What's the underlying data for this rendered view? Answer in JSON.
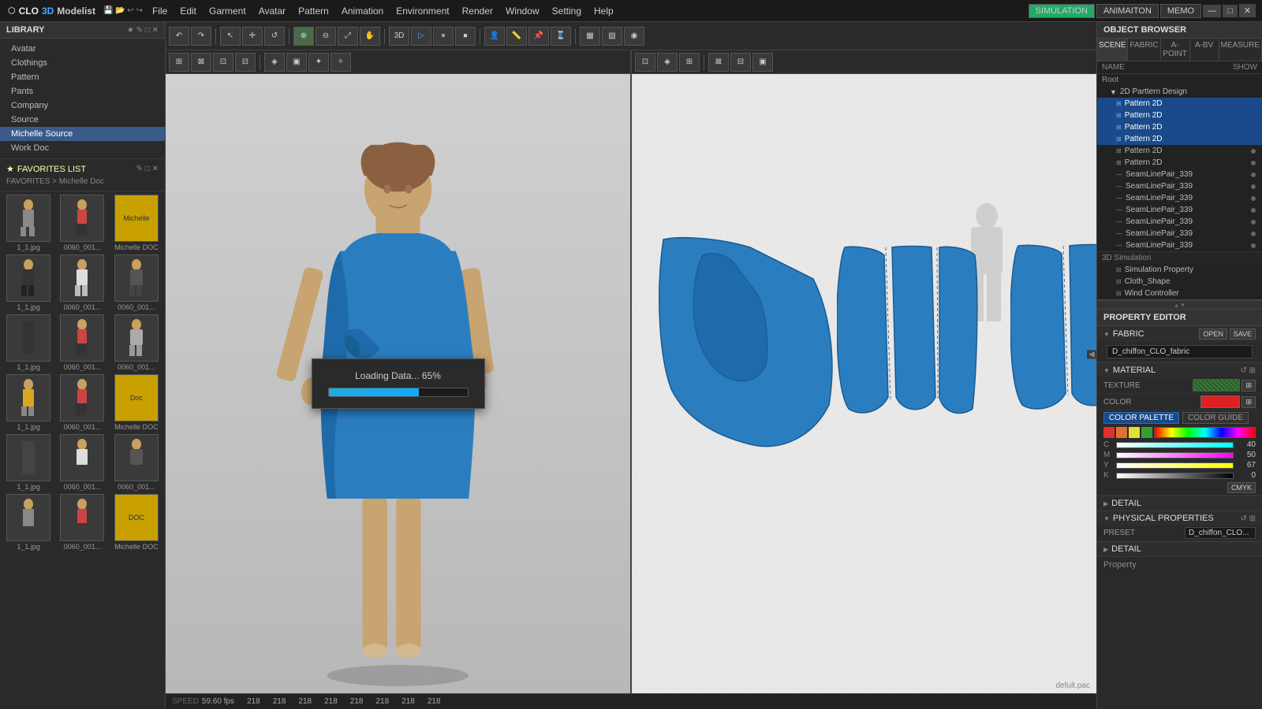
{
  "app": {
    "title": "CLO 3D Modelist",
    "logo_clo": "CLO",
    "logo_3d": "3D",
    "logo_modelist": "Modelist"
  },
  "topbar_buttons": {
    "simulation": "SIMULATION",
    "animation": "ANIMAITON",
    "memo": "MEMO",
    "minimize": "—",
    "maximize": "□",
    "close": "✕"
  },
  "menu": {
    "items": [
      "File",
      "Edit",
      "Garment",
      "Avatar",
      "Pattern",
      "Animation",
      "Environment",
      "Render",
      "Window",
      "Setting",
      "Help"
    ]
  },
  "sidebar": {
    "title": "LIBRARY",
    "nav_items": [
      "Avatar",
      "Clothings",
      "Pattern",
      "Pants",
      "Company",
      "Source",
      "Michelle Source",
      "Work Doc"
    ],
    "active_item": "Michelle Source",
    "favorites_label": "FAVORITES LIST",
    "favorites_path": "FAVORITES > Michelle Doc",
    "thumbnails": [
      {
        "label": "1_1.jpg",
        "type": "figure"
      },
      {
        "label": "0060_001...",
        "type": "figure2"
      },
      {
        "label": "Michelle DOC",
        "type": "yellow"
      },
      {
        "label": "1_1.jpg",
        "type": "figure_dark"
      },
      {
        "label": "0060_001...",
        "type": "figure_stripe"
      },
      {
        "label": "0060_001...",
        "type": "jacket"
      },
      {
        "label": "1_1.jpg",
        "type": "pants"
      },
      {
        "label": "0060_001...",
        "type": "figure2"
      },
      {
        "label": "0060_001...",
        "type": "jacket2"
      },
      {
        "label": "1_1.jpg",
        "type": "figure_yellow"
      },
      {
        "label": "0060_001...",
        "type": "figure2"
      },
      {
        "label": "Michelle DOC",
        "type": "yellow"
      },
      {
        "label": "1_1.jpg",
        "type": "pants"
      },
      {
        "label": "0060_001...",
        "type": "figure_stripe"
      },
      {
        "label": "0060_001...",
        "type": "jacket"
      },
      {
        "label": "1_1.jpg",
        "type": "figure"
      },
      {
        "label": "0060_001...",
        "type": "figure2"
      },
      {
        "label": "Michelle DOC",
        "type": "yellow"
      }
    ]
  },
  "toolbar": {
    "buttons_row1": [
      "↶",
      "↷",
      "⊕",
      "⊖",
      "▷",
      "◁",
      "⤢",
      "↕",
      "↔",
      "↗",
      "↺",
      "↻",
      "⊞",
      "✦",
      "✧",
      "⊡",
      "◈",
      "▣",
      "⊟",
      "⊠",
      "⊹",
      "✂"
    ],
    "buttons_row2": [
      "▦",
      "▧",
      "▨",
      "▩",
      "▪",
      "▫",
      "▬",
      "▭",
      "▮",
      "▯",
      "▰",
      "▱"
    ]
  },
  "loading": {
    "text": "Loading Data... 65%",
    "percent": 65
  },
  "statusbar": {
    "speed_label": "SPEED",
    "speed_val": "59.60 fps",
    "coords": [
      "218",
      "218",
      "218",
      "218",
      "218",
      "218",
      "218",
      "218"
    ]
  },
  "viewport2d": {
    "file_label": "defult.pac"
  },
  "object_browser": {
    "title": "OBJECT BROWSER",
    "tabs": [
      "SCENE",
      "FABRIC",
      "A-POINT",
      "A-BV",
      "MEASURE"
    ],
    "active_tab": "SCENE",
    "name_label": "NAME",
    "show_label": "SHOW",
    "tree": {
      "root": "Root",
      "items": [
        {
          "label": "2D Parttern Design",
          "indent": 1,
          "type": "group",
          "selected": false
        },
        {
          "label": "Pattern 2D",
          "indent": 2,
          "type": "item",
          "selected": true
        },
        {
          "label": "Pattern 2D",
          "indent": 2,
          "type": "item",
          "selected": true
        },
        {
          "label": "Pattern 2D",
          "indent": 2,
          "type": "item",
          "selected": true
        },
        {
          "label": "Pattern 2D",
          "indent": 2,
          "type": "item",
          "selected": true
        },
        {
          "label": "Pattern 2D",
          "indent": 2,
          "type": "item",
          "selected": false,
          "dot": true
        },
        {
          "label": "Pattern 2D",
          "indent": 2,
          "type": "item",
          "selected": false,
          "dot": true
        },
        {
          "label": "SeamLinePair_339",
          "indent": 2,
          "type": "item",
          "selected": false,
          "dot": true
        },
        {
          "label": "SeamLinePair_339",
          "indent": 2,
          "type": "item",
          "selected": false,
          "dot": true
        },
        {
          "label": "SeamLinePair_339",
          "indent": 2,
          "type": "item",
          "selected": false,
          "dot": true
        },
        {
          "label": "SeamLinePair_339",
          "indent": 2,
          "type": "item",
          "selected": false,
          "dot": true
        },
        {
          "label": "SeamLinePair_339",
          "indent": 2,
          "type": "item",
          "selected": false,
          "dot": true
        },
        {
          "label": "SeamLinePair_339",
          "indent": 2,
          "type": "item",
          "selected": false,
          "dot": true
        },
        {
          "label": "SeamLinePair_339",
          "indent": 2,
          "type": "item",
          "selected": false,
          "dot": true
        },
        {
          "label": "3D Simulation",
          "indent": 1,
          "type": "group",
          "selected": false
        },
        {
          "label": "Simulation Property",
          "indent": 2,
          "type": "item",
          "selected": false
        },
        {
          "label": "Cloth_Shape",
          "indent": 2,
          "type": "item",
          "selected": false
        },
        {
          "label": "Wind Controller",
          "indent": 2,
          "type": "item",
          "selected": false
        }
      ]
    }
  },
  "property_editor": {
    "title": "PROPERTY EDITOR",
    "open_label": "OPEN",
    "save_label": "SAVE",
    "section_fabric": "FABRIC",
    "fabric_name": "D_chiffon_CLO_fabric",
    "section_material": "MATERIAL",
    "texture_label": "TEXTURE",
    "color_label": "COLOR",
    "color_palette_label": "COLOR PALETTE",
    "color_guide_label": "COLOR GUIDE",
    "cmyk_values": {
      "c": 40,
      "m": 50,
      "y": 67,
      "k": 0
    },
    "cmyk_label": "CMYK",
    "section_detail": "DETAIL",
    "section_physical": "PHYSICAL PROPERTIES",
    "preset_label": "PRESET",
    "preset_value": "D_chiffon_CLO...",
    "detail2_label": "DETAIL",
    "property_label": "Property"
  }
}
